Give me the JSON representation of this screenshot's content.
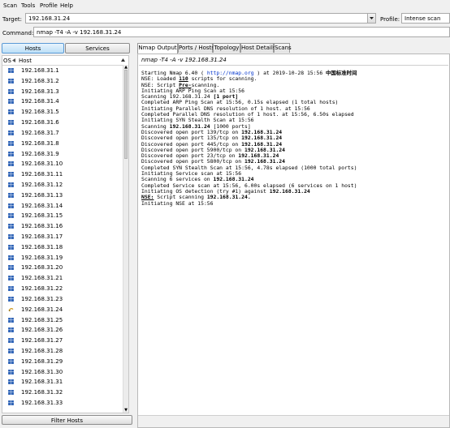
{
  "menu": {
    "scan": "Scan",
    "tools": "Tools",
    "profile": "Profile",
    "help": "Help"
  },
  "target": {
    "label": "Target:",
    "value": "192.168.31.24"
  },
  "profile": {
    "label": "Profile:",
    "value": "Intense scan"
  },
  "command": {
    "label": "Command:",
    "value": "nmap -T4 -A -v 192.168.31.24"
  },
  "buttons": {
    "hosts": "Hosts",
    "services": "Services",
    "filter_hosts": "Filter Hosts"
  },
  "host_columns": {
    "os": "OS",
    "host": "Host"
  },
  "hosts": [
    "192.168.31.1",
    "192.168.31.2",
    "192.168.31.3",
    "192.168.31.4",
    "192.168.31.5",
    "192.168.31.6",
    "192.168.31.7",
    "192.168.31.8",
    "192.168.31.9",
    "192.168.31.10",
    "192.168.31.11",
    "192.168.31.12",
    "192.168.31.13",
    "192.168.31.14",
    "192.168.31.15",
    "192.168.31.16",
    "192.168.31.17",
    "192.168.31.18",
    "192.168.31.19",
    "192.168.31.20",
    "192.168.31.21",
    "192.168.31.22",
    "192.168.31.23",
    "192.168.31.24",
    "192.168.31.25",
    "192.168.31.26",
    "192.168.31.27",
    "192.168.31.28",
    "192.168.31.29",
    "192.168.31.30",
    "192.168.31.31",
    "192.168.31.32",
    "192.168.31.33"
  ],
  "tabs": [
    "Nmap Output",
    "Ports / Hosts",
    "Topology",
    "Host Details",
    "Scans"
  ],
  "output": {
    "command": "nmap -T4 -A -v 192.168.31.24",
    "lines": {
      "l1a": "Starting Nmap 6.40 ( ",
      "l1_link": "http://nmap.org",
      "l1b": " ) at 2019-10-28 15:56 ",
      "l1c": "中国标准时间",
      "l2a": "NSE: Loaded ",
      "l2b": "110",
      "l2c": " scripts for scanning.",
      "l3a": "NSE: Script ",
      "l3b": "Pre-",
      "l3c": "scanning.",
      "l4": "Initiating ARP Ping Scan at 15:56",
      "l5a": "Scanning 192.168.31.24 ",
      "l5b": "[1 port]",
      "l6": "Completed ARP Ping Scan at 15:56, 0.15s elapsed (1 total hosts)",
      "l7": "Initiating Parallel DNS resolution of 1 host. at 15:56",
      "l8": "Completed Parallel DNS resolution of 1 host. at 15:56, 6.50s elapsed",
      "l9": "Initiating SYN Stealth Scan at 15:56",
      "l10a": "Scanning ",
      "l10b": "192.168.31.24",
      "l10c": " [1000 ports]",
      "l11a": "Discovered open port 139/tcp on ",
      "l11b": "192.168.31.24",
      "l12a": "Discovered open port 135/tcp on ",
      "l12b": "192.168.31.24",
      "l13a": "Discovered open port 445/tcp on ",
      "l13b": "192.168.31.24",
      "l14a": "Discovered open port 5900/tcp on ",
      "l14b": "192.168.31.24",
      "l15a": "Discovered open port 23/tcp on ",
      "l15b": "192.168.31.24",
      "l16a": "Discovered open port 5800/tcp on ",
      "l16b": "192.168.31.24",
      "l17": "Completed SYN Stealth Scan at 15:56, 4.78s elapsed (1000 total ports)",
      "l18": "Initiating Service scan at 15:56",
      "l19a": "Scanning 6 services on ",
      "l19b": "192.168.31.24",
      "l20": "Completed Service scan at 15:56, 6.00s elapsed (6 services on 1 host)",
      "l21a": "Initiating OS detection (try #1) against ",
      "l21b": "192.168.31.24",
      "l22a": "NSE:",
      "l22b": " Script scanning ",
      "l22c": "192.168.31.24.",
      "l23": "Initiating NSE at 15:56"
    }
  },
  "colors": {
    "accent": "#5a9ad6",
    "link": "#0033cc"
  }
}
